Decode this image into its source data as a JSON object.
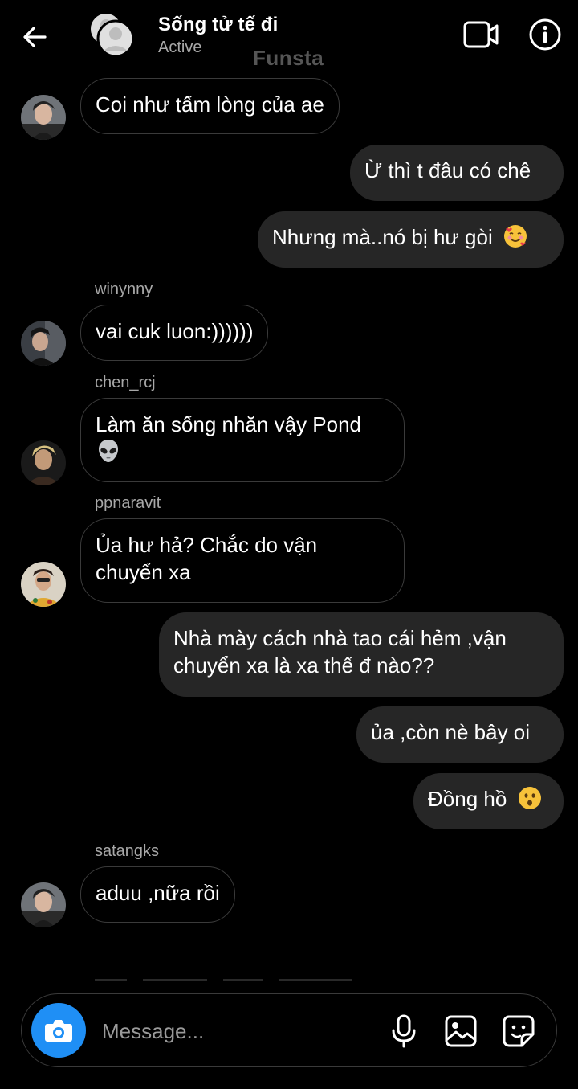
{
  "header": {
    "title": "Sống tử tế đi",
    "status": "Active",
    "watermark": "Funsta"
  },
  "messages": [
    {
      "side": "in",
      "sender": "",
      "text": "Coi như tấm lòng của ae"
    },
    {
      "side": "out",
      "text": "Ừ thì t đâu có chê"
    },
    {
      "side": "out",
      "text": "Nhưng mà..nó bị hư gòi",
      "emoji": "smiling-face-with-hearts"
    },
    {
      "side": "in",
      "sender": "winynny",
      "text": "vai cuk luon:))))))"
    },
    {
      "side": "in",
      "sender": "chen_rcj",
      "text_lines": [
        "Làm ăn sống nhăn vậy Pond",
        ""
      ],
      "emoji": "alien"
    },
    {
      "side": "in",
      "sender": "ppnaravit",
      "text_lines": [
        "Ủa hư hả? Chắc do vận",
        "chuyển xa"
      ]
    },
    {
      "side": "out",
      "text_lines": [
        "Nhà mày cách nhà tao cái hẻm ,vận",
        "chuyển xa là xa thế đ nào??"
      ]
    },
    {
      "side": "out",
      "text": "ủa ,còn nè bây oi"
    },
    {
      "side": "out",
      "text": "Đồng hồ",
      "emoji": "hushed-face"
    },
    {
      "side": "in",
      "sender": "satangks",
      "text": "aduu ,nữa rồi"
    }
  ],
  "composer": {
    "placeholder": "Message..."
  },
  "icons": {
    "back": "arrow-left-icon",
    "video": "video-call-icon",
    "info": "info-icon",
    "camera": "camera-icon",
    "mic": "microphone-icon",
    "image": "gallery-icon",
    "sticker": "sticker-icon"
  },
  "colors": {
    "background": "#000000",
    "outgoing_bubble": "#262626",
    "incoming_border": "#3a3a3a",
    "camera_button": "#1f8ff5",
    "secondary_text": "#a8a8a8"
  }
}
